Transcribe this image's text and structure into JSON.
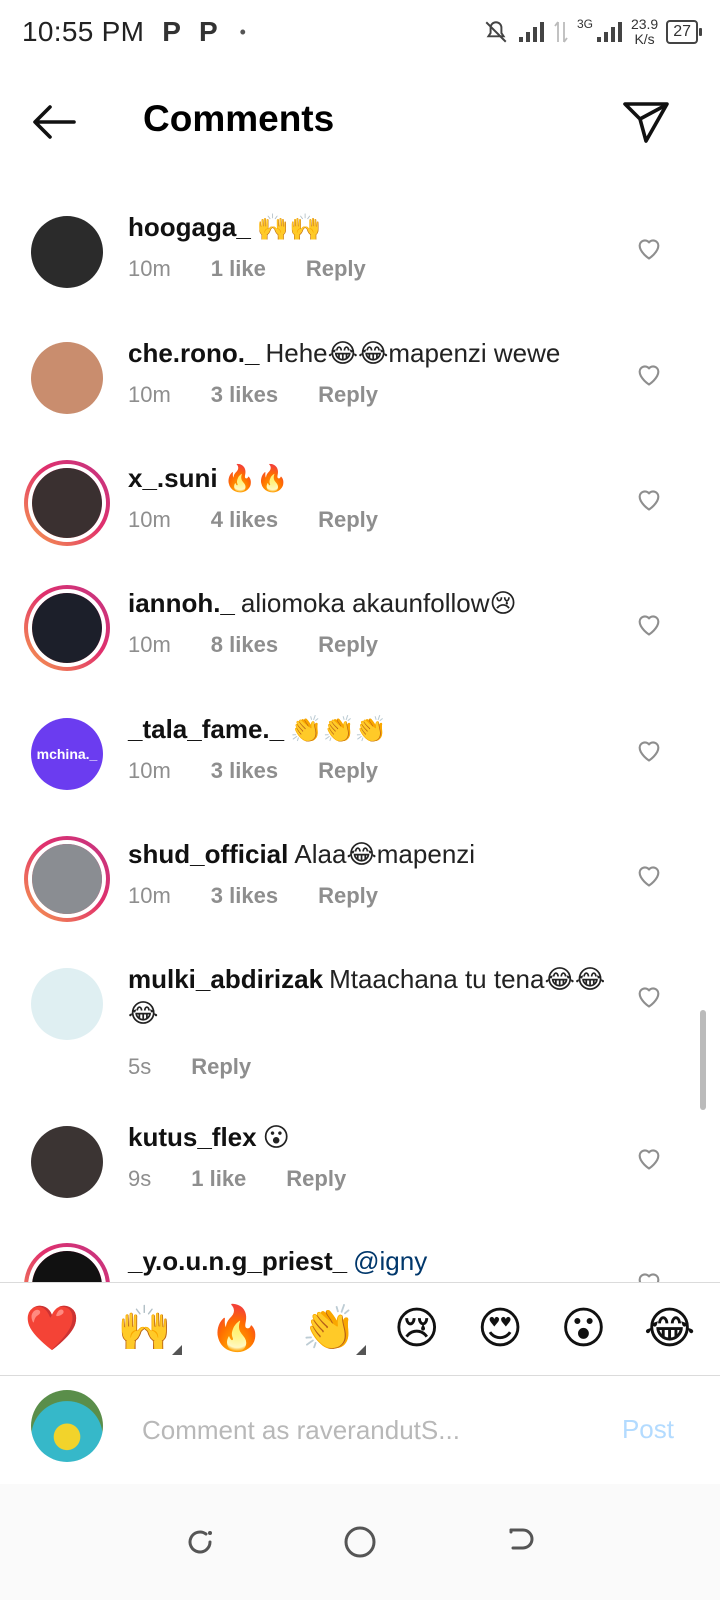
{
  "status_bar": {
    "time": "10:55 PM",
    "notif_1": "P",
    "notif_2": "P",
    "dot": "•",
    "net_3g": "3G",
    "speed_value": "23.9",
    "speed_unit": "K/s",
    "battery": "27"
  },
  "header": {
    "title": "Comments"
  },
  "comments": [
    {
      "username": "hoogaga_",
      "text": "🙌🙌",
      "time": "10m",
      "likes": "1 like",
      "reply": "Reply",
      "avatar_color": "#2b2b2b",
      "ring": false
    },
    {
      "username": "che.rono._",
      "text": "Hehe😂😂mapenzi wewe",
      "time": "10m",
      "likes": "3 likes",
      "reply": "Reply",
      "avatar_color": "#c98d6e",
      "ring": false
    },
    {
      "username": "x_.suni",
      "text": "🔥🔥",
      "time": "10m",
      "likes": "4 likes",
      "reply": "Reply",
      "avatar_color": "#3a3030",
      "ring": true
    },
    {
      "username": "iannoh._",
      "text": "aliomoka akaunfollow😢",
      "time": "10m",
      "likes": "8 likes",
      "reply": "Reply",
      "avatar_color": "#1c1f2a",
      "ring": true
    },
    {
      "username": "_tala_fame._",
      "text": "👏👏👏",
      "time": "10m",
      "likes": "3 likes",
      "reply": "Reply",
      "avatar_color": "#6b3cf0",
      "avatar_label": "mchina._",
      "ring": false
    },
    {
      "username": "shud_official",
      "text": "Alaa😂mapenzi",
      "time": "10m",
      "likes": "3 likes",
      "reply": "Reply",
      "avatar_color": "#8a8d92",
      "ring": true
    },
    {
      "username": "mulki_abdirizak",
      "text": "Mtaachana tu tena😂😂😂",
      "time": "5s",
      "likes": "",
      "reply": "Reply",
      "avatar_color": "#dfeff2",
      "ring": false
    },
    {
      "username": "kutus_flex",
      "text": "😮",
      "time": "9s",
      "likes": "1 like",
      "reply": "Reply",
      "avatar_color": "#3b3433",
      "ring": false
    },
    {
      "username": "_y.o.u.n.g_priest_",
      "text": "@igny",
      "time": "",
      "likes": "",
      "reply": "",
      "avatar_color": "#111111",
      "ring": true
    }
  ],
  "emoji_bar": [
    "❤️",
    "🙌",
    "🔥",
    "👏",
    "😢",
    "😍",
    "😮",
    "😂"
  ],
  "composer": {
    "placeholder": "Comment as raverandutS...",
    "post_label": "Post"
  },
  "colors": {
    "accent_blue": "#0095f6",
    "post_disabled": "#b3dbff",
    "meta_gray": "#8e8e8e"
  }
}
